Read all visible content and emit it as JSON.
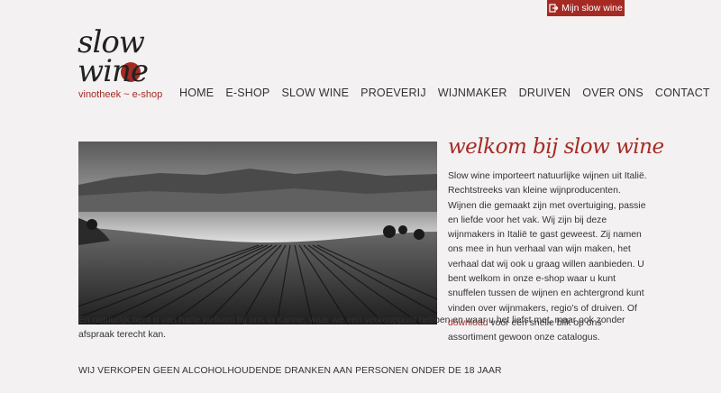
{
  "topbar": {
    "account_label": "Mijn slow wine"
  },
  "brand": {
    "word1": "slow",
    "word2": "wine",
    "tagline": "vinotheek ~ e-shop",
    "accent": "#a52a24"
  },
  "nav": [
    {
      "label": "HOME"
    },
    {
      "label": "E-SHOP"
    },
    {
      "label": "SLOW WINE"
    },
    {
      "label": "PROEVERIJ"
    },
    {
      "label": "WIJNMAKER"
    },
    {
      "label": "DRUIVEN"
    },
    {
      "label": "OVER ONS"
    },
    {
      "label": "CONTACT"
    }
  ],
  "main": {
    "headline": "welkom bij slow wine",
    "intro_before": "Slow wine importeert natuurlijke wijnen uit Italië. Rechtstreeks van kleine wijnproducenten. Wijnen die gemaakt zijn met overtuiging, passie en liefde voor het vak. Wij zijn bij deze wijnmakers in Italië te gast geweest. Zij namen ons mee in hun verhaal van wijn maken, het verhaal dat wij ook u graag willen aanbieden. U bent welkom in onze e-shop waar u kunt snuffelen tussen de wijnen en achtergrond kunt vinden over wijnmakers, regio's of druiven. Of",
    "download_link": "download",
    "intro_after": "voor een snelle blik op ons assortiment gewoon onze catalogus.",
    "continuation": "En natuurlijk bent u van harte welkom bij ons in Kanne, waar we een verkooppunt hebben en waar u het liefst met, maar ook zonder afspraak terecht kan.",
    "notice": "WIJ VERKOPEN GEEN ALCOHOLHOUDENDE DRANKEN AAN PERSONEN ONDER DE 18 JAAR"
  }
}
